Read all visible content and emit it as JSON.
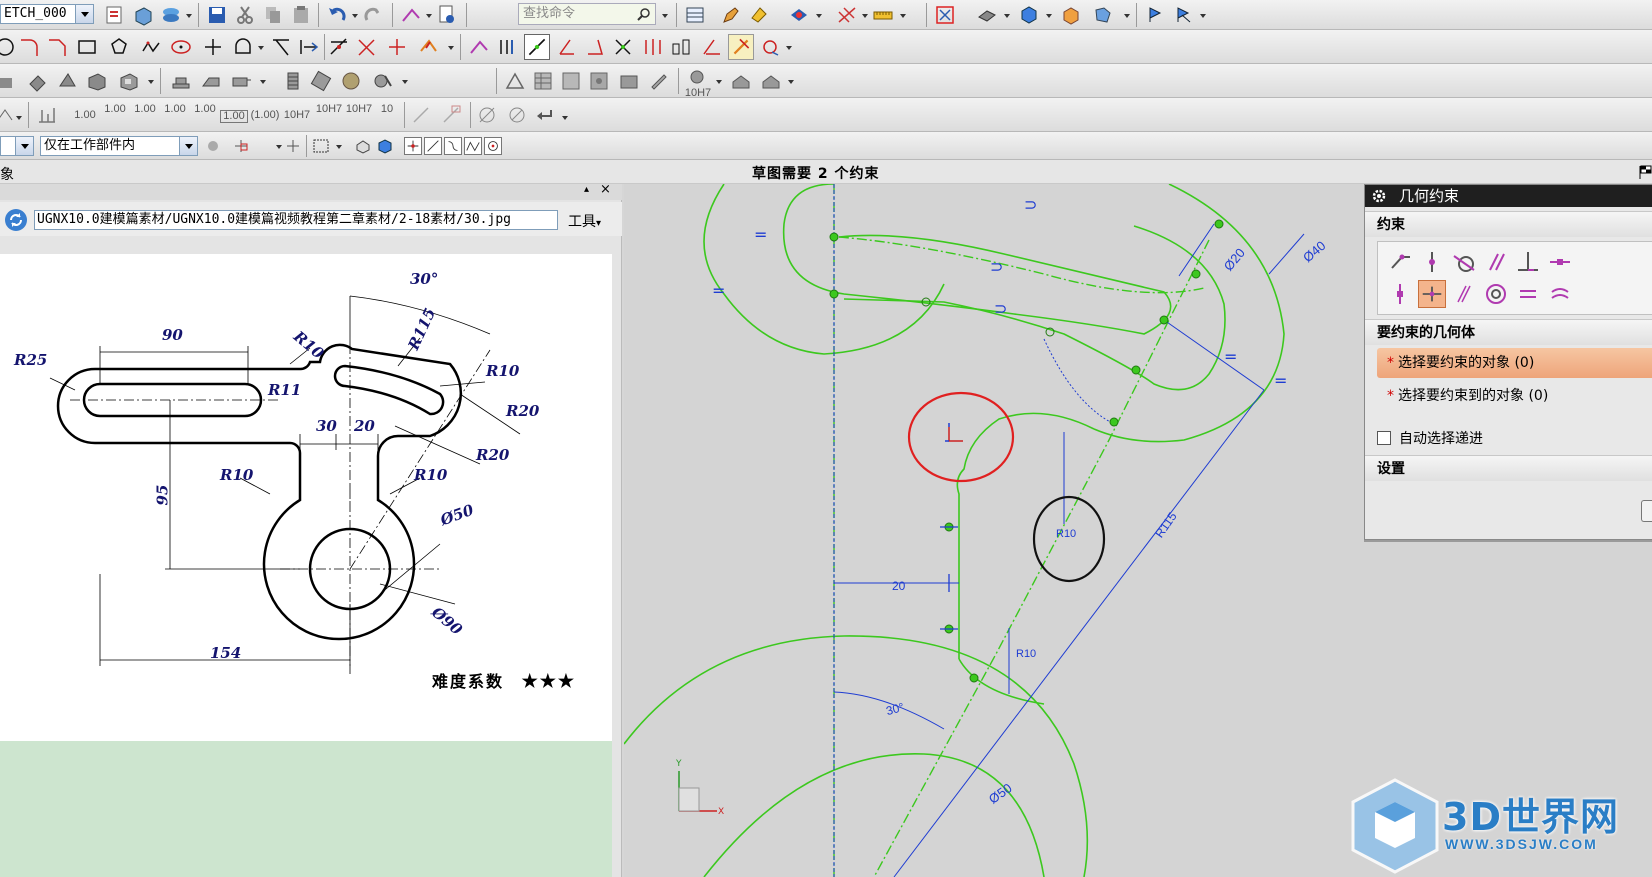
{
  "toolbar": {
    "sketch_name": "ETCH_000",
    "search_placeholder": "查找命令",
    "scope_filter": "仅在工作部件内",
    "dims": [
      "1.00",
      "1.00",
      "1.00",
      "1.00",
      "1.00",
      "1.00",
      "(1.00)",
      "10H7",
      "10H7",
      "10H7",
      "10"
    ],
    "row3_label": "10H7"
  },
  "status": {
    "left_text": "象",
    "message": "草图需要 2 个约束"
  },
  "left_panel": {
    "path": "UGNX10.0建模篇素材/UGNX10.0建模篇视频教程第二章素材/2-18素材/30.jpg",
    "tools_label": "工具"
  },
  "reference_drawing": {
    "dimensions": [
      "90",
      "R25",
      "R11",
      "R10",
      "R115",
      "30°",
      "R10",
      "R20",
      "R20",
      "30",
      "20",
      "95",
      "R10",
      "R10",
      "Ø50",
      "Ø90",
      "154"
    ],
    "difficulty_label": "难度系数",
    "difficulty_stars": "★★★"
  },
  "sketch": {
    "dimensions": [
      "Ø20",
      "Ø40",
      "R10",
      "R115",
      "20",
      "R10",
      "30°",
      "Ø50"
    ]
  },
  "dialog": {
    "title": "几何约束",
    "constraints_header": "约束",
    "geometry_header": "要约束的几何体",
    "select_object": "选择要约束的对象 (0)",
    "select_target": "选择要约束到的对象 (0)",
    "auto_advance": "自动选择递进",
    "settings_header": "设置"
  },
  "watermark": {
    "brand": "3D世界网",
    "url": "WWW.3DSJW.COM"
  },
  "colors": {
    "sketch_green": "#3cc81e",
    "dimension_blue": "#1e3cd2",
    "highlight_red": "#e02020",
    "active_orange": "#f0a878"
  }
}
